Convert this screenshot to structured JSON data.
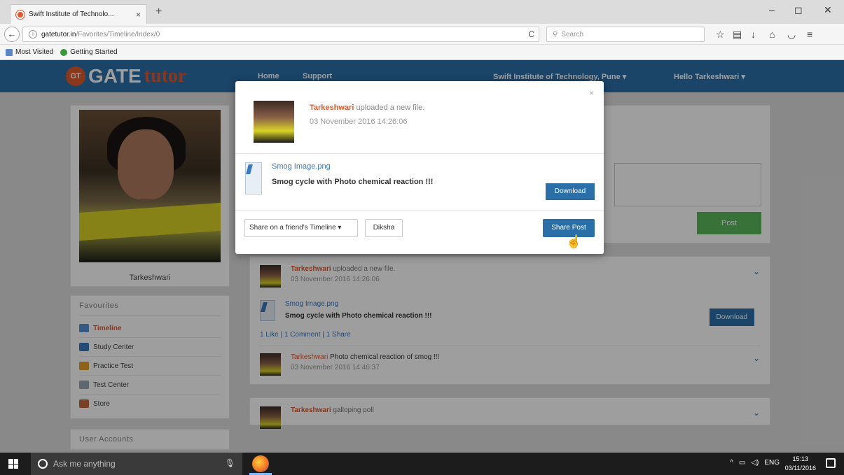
{
  "browser": {
    "tab_title": "Swift Institute of Technolo...",
    "tab_close": "×",
    "new_tab": "+",
    "url_domain": "gatetutor.in",
    "url_path": "/Favorites/Timeline/Index/0",
    "reload": "C",
    "search_placeholder": "Search",
    "bookmarks": [
      "Most Visited",
      "Getting Started"
    ]
  },
  "site": {
    "logo_badge": "GT",
    "logo_main": "GATE",
    "logo_accent": "tutor",
    "nav": {
      "home": "Home",
      "support": "Support",
      "institute": "Swift Institute of Technology, Pune",
      "greeting": "Hello Tarkeshwari"
    }
  },
  "profile": {
    "name": "Tarkeshwari"
  },
  "favourites": {
    "title": "Favourites",
    "items": [
      "Timeline",
      "Study Center",
      "Practice Test",
      "Test Center",
      "Store"
    ]
  },
  "user_accounts": {
    "title": "User Accounts"
  },
  "post_box": {
    "post_label": "Post"
  },
  "feed": [
    {
      "user": "Tarkeshwari",
      "action": "uploaded a new file.",
      "date": "03 November 2016 14:26:06",
      "file_name": "Smog Image.png",
      "file_desc": "Smog cycle with Photo chemical reaction !!!",
      "download": "Download",
      "stats": "1 Like | 1 Comment | 1 Share",
      "comment_user": "Tarkeshwari",
      "comment_text": "Photo chemical reaction of smog !!!",
      "comment_date": "03 November 2016 14:46:37"
    },
    {
      "user": "Tarkeshwari",
      "action": "galloping poll"
    }
  ],
  "modal": {
    "close": "×",
    "user": "Tarkeshwari",
    "action": "uploaded a new file.",
    "date": "03 November 2016 14:26:06",
    "file_name": "Smog Image.png",
    "file_desc": "Smog cycle with Photo chemical reaction !!!",
    "download": "Download",
    "share_select": "Share on a friend's Timeline ▾",
    "friend": "Diksha",
    "share_post": "Share Post"
  },
  "taskbar": {
    "search_placeholder": "Ask me anything",
    "lang": "ENG",
    "time": "15:13",
    "date": "03/11/2016"
  },
  "colors": {
    "header_blue": "#2a6fa8",
    "accent_orange": "#e05a2c",
    "post_green": "#5cb85c"
  }
}
